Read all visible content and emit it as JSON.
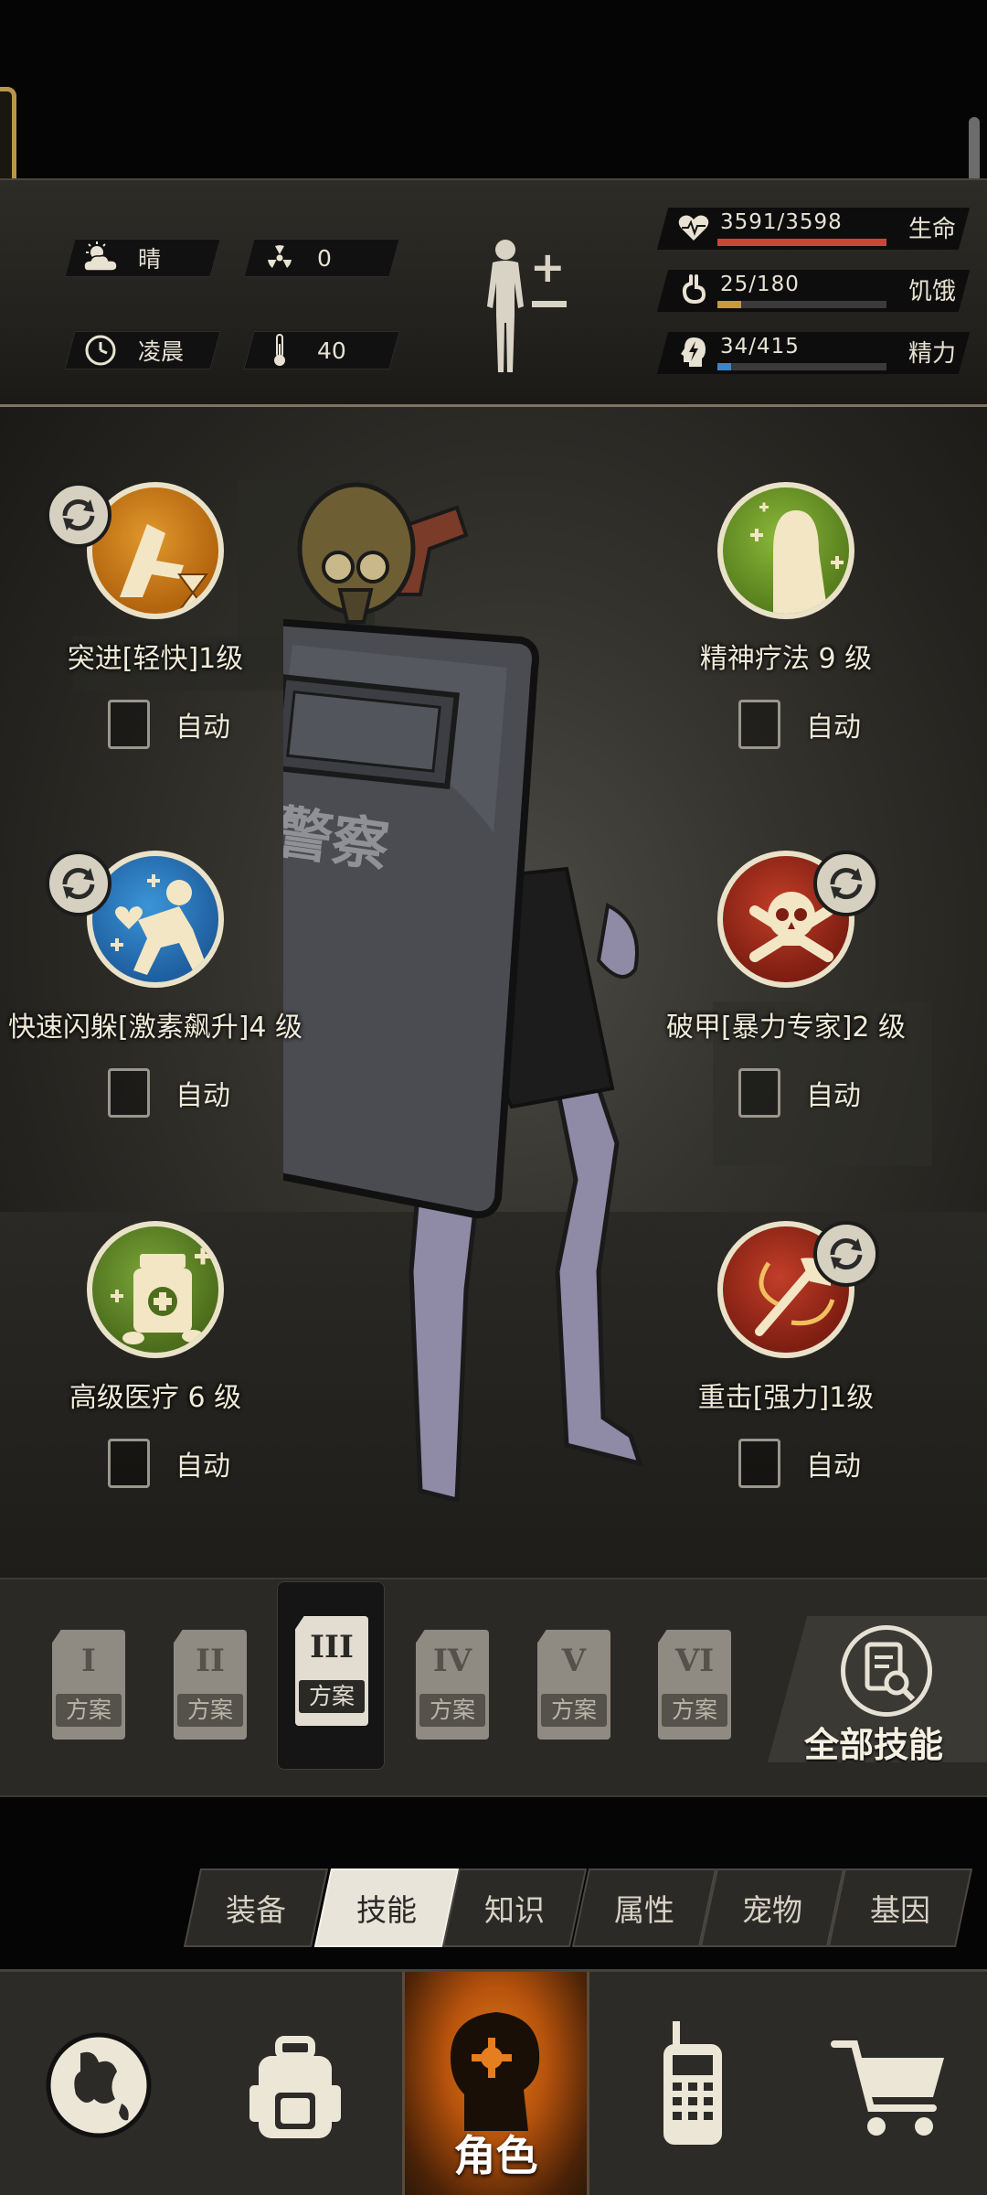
{
  "status": {
    "weather": {
      "icon": "cloudy-sun-icon",
      "label": "晴"
    },
    "radiation": {
      "icon": "radiation-icon",
      "value": "0"
    },
    "time_of_day": {
      "icon": "clock-icon",
      "label": "凌晨"
    },
    "temperature": {
      "icon": "thermometer-icon",
      "value": "40"
    },
    "hp": {
      "value": "3591/3598",
      "label": "生命",
      "fraction": 0.998,
      "color": "#c9473a",
      "icon": "heart-pulse-icon"
    },
    "hunger": {
      "value": "25/180",
      "label": "饥饿",
      "fraction": 0.139,
      "color": "#c79a3a",
      "icon": "stomach-icon"
    },
    "energy": {
      "value": "34/415",
      "label": "精力",
      "fraction": 0.082,
      "color": "#3b86c9",
      "icon": "head-lightning-icon"
    }
  },
  "skills": [
    {
      "name": "突进[轻快]1级",
      "auto_label": "自动",
      "auto_checked": false,
      "icon": "dash-hourglass-icon",
      "color": "#cf7d1d",
      "swap": true
    },
    {
      "name": "精神疗法 9 级",
      "auto_label": "自动",
      "auto_checked": false,
      "icon": "mental-therapy-icon",
      "color": "#6e9a2c",
      "swap": false
    },
    {
      "name": "快速闪躲[激素飙升]4 级",
      "auto_label": "自动",
      "auto_checked": false,
      "icon": "dodge-icon",
      "color": "#2e7fc4",
      "swap": true
    },
    {
      "name": "破甲[暴力专家]2 级",
      "auto_label": "自动",
      "auto_checked": false,
      "icon": "skull-crossbones-icon",
      "color": "#a8301f",
      "swap": true
    },
    {
      "name": "高级医疗 6 级",
      "auto_label": "自动",
      "auto_checked": false,
      "icon": "medicine-bottle-icon",
      "color": "#5f8a2b",
      "swap": false
    },
    {
      "name": "重击[强力]1级",
      "auto_label": "自动",
      "auto_checked": false,
      "icon": "heavy-strike-icon",
      "color": "#a8301f",
      "swap": true
    }
  ],
  "plans": [
    {
      "numeral": "I",
      "label": "方案",
      "active": false
    },
    {
      "numeral": "II",
      "label": "方案",
      "active": false
    },
    {
      "numeral": "III",
      "label": "方案",
      "active": true
    },
    {
      "numeral": "IV",
      "label": "方案",
      "active": false
    },
    {
      "numeral": "V",
      "label": "方案",
      "active": false
    },
    {
      "numeral": "VI",
      "label": "方案",
      "active": false
    }
  ],
  "all_skills_label": "全部技能",
  "subtabs": [
    "装备",
    "技能",
    "知识",
    "属性",
    "宠物",
    "基因"
  ],
  "subtab_selected": 1,
  "bottom_nav": {
    "items": [
      "globe-icon",
      "backpack-icon",
      "character-icon",
      "walkie-talkie-icon",
      "cart-icon"
    ],
    "selected_label": "角色"
  },
  "character": {
    "shield_text": "警察"
  }
}
